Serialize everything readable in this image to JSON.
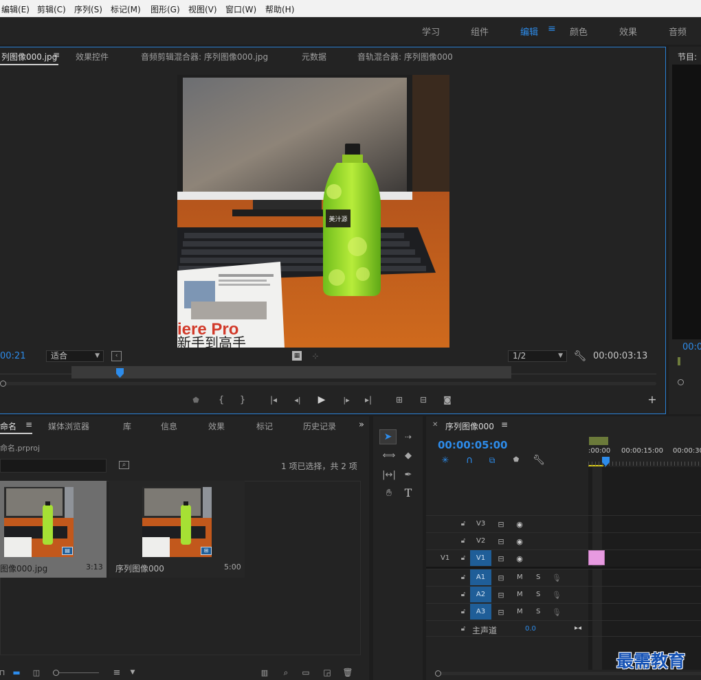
{
  "menu": [
    "编辑(E)",
    "剪辑(C)",
    "序列(S)",
    "标记(M)",
    "图形(G)",
    "视图(V)",
    "窗口(W)",
    "帮助(H)"
  ],
  "workspaces": {
    "learn": "学习",
    "assembly": "组件",
    "editing": "编辑",
    "color": "颜色",
    "effects": "效果",
    "audio": "音频"
  },
  "source_panel": {
    "tabs": [
      "列图像000.jpg",
      "效果控件",
      "音频剪辑混合器: 序列图像000.jpg",
      "元数据",
      "音轨混合器: 序列图像000"
    ],
    "timecode_in": "00:21",
    "zoom_select": "适合",
    "resolution_select": "1/2",
    "timecode_duration": "00:00:03:13",
    "playhead_fraction": 0.11
  },
  "preview_image": {
    "book_title": "iere Pro",
    "book_subtitle": "新手到高手",
    "bottle_label": "美汁源"
  },
  "program_panel": {
    "tab": "节目:",
    "timecode": "00:0"
  },
  "project_panel": {
    "tabs": [
      "命名",
      "媒体浏览器",
      "库",
      "信息",
      "效果",
      "标记",
      "历史记录"
    ],
    "project_file": "命名.prproj",
    "selection_info": "1 项已选择，共 2 项",
    "items": [
      {
        "name": "图像000.jpg",
        "duration": "3:13"
      },
      {
        "name": "序列图像000",
        "duration": "5:00"
      }
    ]
  },
  "timeline": {
    "sequence_name": "序列图像000",
    "timecode": "00:00:05:00",
    "ruler": [
      ":00:00",
      "00:00:15:00",
      "00:00:30"
    ],
    "video_tracks": [
      {
        "name": "V3",
        "source": ""
      },
      {
        "name": "V2",
        "source": ""
      },
      {
        "name": "V1",
        "source": "V1"
      }
    ],
    "audio_tracks": [
      {
        "name": "A1",
        "source": "",
        "m": "M",
        "s": "S"
      },
      {
        "name": "A2",
        "source": "",
        "m": "M",
        "s": "S"
      },
      {
        "name": "A3",
        "source": "",
        "m": "M",
        "s": "S"
      }
    ],
    "master": {
      "label": "主声道",
      "value": "0.0"
    }
  },
  "watermark": "最需教育",
  "colors": {
    "accent_blue": "#2d8ceb",
    "clip_pink": "#e79ae0",
    "track_blue": "#1f5e98",
    "panel_bg": "#232323"
  }
}
